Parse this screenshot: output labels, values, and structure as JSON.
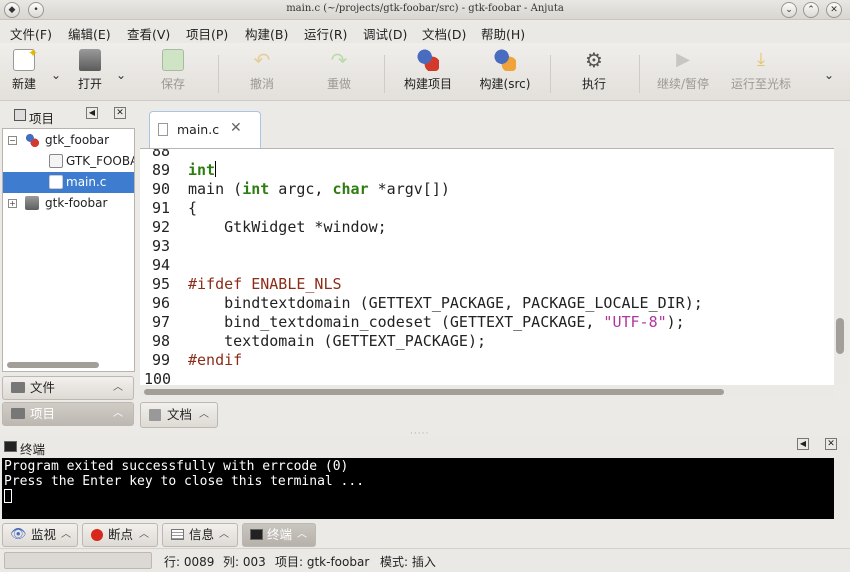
{
  "window": {
    "title": "main.c (~/projects/gtk-foobar/src) - gtk-foobar - Anjuta"
  },
  "menubar": {
    "items": [
      "文件(F)",
      "编辑(E)",
      "查看(V)",
      "项目(P)",
      "构建(B)",
      "运行(R)",
      "调试(D)",
      "文档(D)",
      "帮助(H)"
    ]
  },
  "toolbar": {
    "new": "新建",
    "open": "打开",
    "save": "保存",
    "undo": "撤消",
    "redo": "重做",
    "build_project": "构建项目",
    "build_src": "构建(src)",
    "execute": "执行",
    "continue_pause": "继续/暂停",
    "run_to_cursor": "运行至光标"
  },
  "project_panel": {
    "title": "项目",
    "tree": [
      {
        "label": "gtk_foobar",
        "level": 0,
        "expanded": true
      },
      {
        "label": "GTK_FOOBAR",
        "level": 1,
        "expanded": false
      },
      {
        "label": "main.c",
        "level": 1,
        "selected": true
      },
      {
        "label": "gtk-foobar",
        "level": 0,
        "expanded": false
      }
    ],
    "tabs": [
      "文件",
      "项目"
    ]
  },
  "editor": {
    "tab_label": "main.c",
    "lines": [
      {
        "n": "88",
        "text": ""
      },
      {
        "n": "89",
        "text": "int"
      },
      {
        "n": "90",
        "text": "main (int argc, char *argv[])"
      },
      {
        "n": "91",
        "text": "{"
      },
      {
        "n": "92",
        "text": "    GtkWidget *window;"
      },
      {
        "n": "93",
        "text": ""
      },
      {
        "n": "94",
        "text": ""
      },
      {
        "n": "95",
        "text": "#ifdef ENABLE_NLS"
      },
      {
        "n": "96",
        "text": "    bindtextdomain (GETTEXT_PACKAGE, PACKAGE_LOCALE_DIR);"
      },
      {
        "n": "97",
        "text": "    bind_textdomain_codeset (GETTEXT_PACKAGE, \"UTF-8\");"
      },
      {
        "n": "98",
        "text": "    textdomain (GETTEXT_PACKAGE);"
      },
      {
        "n": "99",
        "text": "#endif"
      },
      {
        "n": "100",
        "text": ""
      }
    ],
    "documents_tab": "文档"
  },
  "terminal": {
    "title": "终端",
    "output": [
      "Program exited successfully with errcode (0)",
      "Press the Enter key to close this terminal ..."
    ]
  },
  "bottom_tabs": [
    "监视",
    "断点",
    "信息",
    "终端"
  ],
  "statusbar": {
    "line": "行: 0089",
    "col": "列: 003",
    "project": "项目: gtk-foobar",
    "mode": "模式: 插入"
  },
  "colors": {
    "selection": "#3d7ccf",
    "keyword": "#2e7d12",
    "preprocessor": "#8b2d1a",
    "string": "#b0369f"
  }
}
